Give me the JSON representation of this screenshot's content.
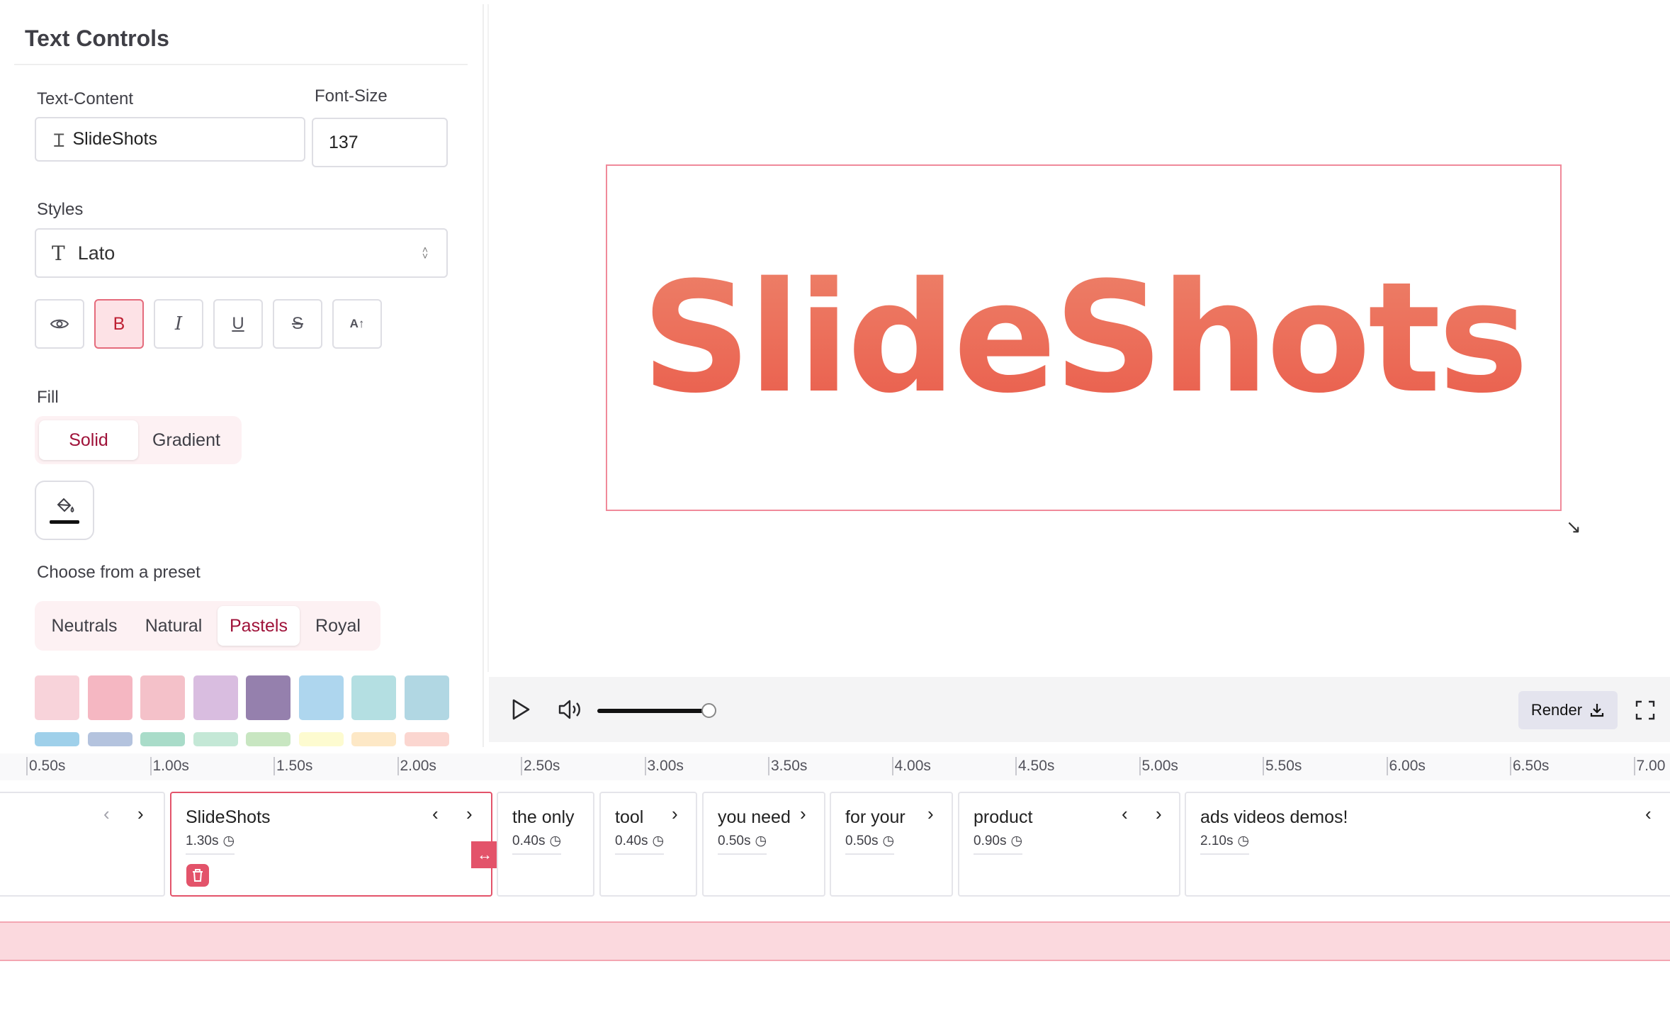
{
  "panel": {
    "title": "Text Controls",
    "text_content_label": "Text-Content",
    "text_content_value": "SlideShots",
    "font_size_label": "Font-Size",
    "font_size_value": "137",
    "styles_label": "Styles",
    "font_family": "Lato",
    "fill_label": "Fill",
    "fill_tabs": [
      "Solid",
      "Gradient"
    ],
    "fill_selected": "Solid",
    "preset_label": "Choose from a preset",
    "preset_tabs": [
      "Neutrals",
      "Natural",
      "Pastels",
      "Royal"
    ],
    "preset_selected": "Pastels",
    "swatches_row1": [
      "#f8d3da",
      "#f5b7c2",
      "#f4c1c9",
      "#d9bde0",
      "#9580ad",
      "#aed6ee",
      "#b4dfe2",
      "#b1d7e3"
    ],
    "swatches_row2": [
      "#9fd0ea",
      "#b4c3de",
      "#a9dcc9",
      "#c4e8d6",
      "#c8e6c1",
      "#fdfbd0",
      "#fde8c6",
      "#fbd6d0"
    ]
  },
  "canvas": {
    "text": "SlideShots",
    "gradient_top": "#ef9479",
    "gradient_bottom": "#e84a3c"
  },
  "player": {
    "volume_level": 0.95,
    "render_label": "Render"
  },
  "ruler": [
    "0.50s",
    "1.00s",
    "1.50s",
    "2.00s",
    "2.50s",
    "3.00s",
    "3.50s",
    "4.00s",
    "4.50s",
    "5.00s",
    "5.50s",
    "6.00s",
    "6.50s",
    "7.00"
  ],
  "clips": [
    {
      "label": "",
      "duration": ""
    },
    {
      "label": "SlideShots",
      "duration": "1.30s"
    },
    {
      "label": "the only",
      "duration": "0.40s"
    },
    {
      "label": "tool",
      "duration": "0.40s"
    },
    {
      "label": "you need",
      "duration": "0.50s"
    },
    {
      "label": "for your",
      "duration": "0.50s"
    },
    {
      "label": "product",
      "duration": "0.90s"
    },
    {
      "label": "ads videos demos!",
      "duration": "2.10s"
    }
  ],
  "colors": {
    "accent": "#e3536a",
    "accent_dark": "#9f1239",
    "track": "#fbd9de"
  }
}
